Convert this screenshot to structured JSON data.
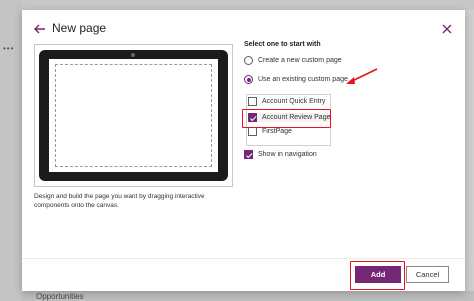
{
  "background": {
    "bottom_item": "Opportunities"
  },
  "dialog": {
    "title": "New page",
    "description": "Design and build the page you want by dragging interactive components onto the canvas.",
    "section_label": "Select one to start with",
    "options": [
      {
        "label": "Create a new custom page",
        "checked": false
      },
      {
        "label": "Use an existing custom page",
        "checked": true
      }
    ],
    "pages": [
      {
        "label": "Account Quick Entry",
        "checked": false
      },
      {
        "label": "Account Review Page",
        "checked": true
      },
      {
        "label": "FirstPage",
        "checked": false
      }
    ],
    "show_in_navigation": {
      "label": "Show in navigation",
      "checked": true
    },
    "add_label": "Add",
    "cancel_label": "Cancel"
  },
  "colors": {
    "accent": "#742774",
    "annotation": "#e81123"
  }
}
